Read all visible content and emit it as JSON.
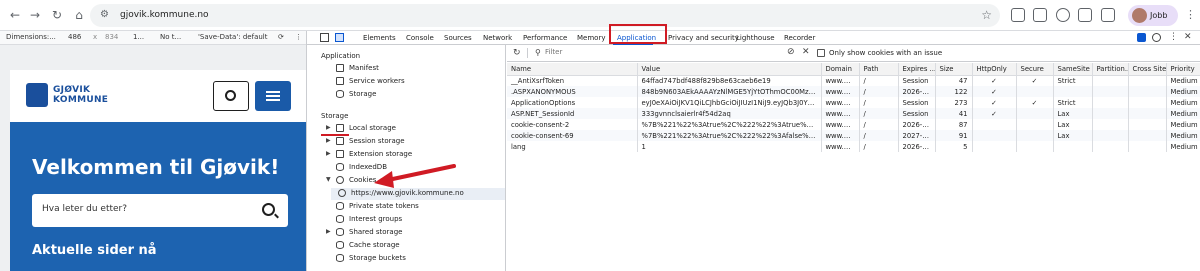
{
  "browser": {
    "url": "gjovik.kommune.no",
    "profile_name": "Jobb"
  },
  "device_toolbar": {
    "dimensions": "Dimensions:...",
    "width": "486",
    "times": "x",
    "height": "834",
    "zoom": "1...",
    "throttle": "No t...",
    "save_data": "'Save-Data': default"
  },
  "site": {
    "logo_line1": "GJØVIK",
    "logo_line2": "KOMMUNE",
    "hero_title": "Velkommen til Gjøvik!",
    "search_placeholder": "Hva leter du etter?",
    "section_heading": "Aktuelle sider nå"
  },
  "devtools": {
    "tabs": [
      "Elements",
      "Console",
      "Sources",
      "Network",
      "Performance",
      "Memory",
      "Application",
      "Privacy and security",
      "Lighthouse",
      "Recorder"
    ],
    "active_tab": "Application",
    "sidebar": {
      "application_heading": "Application",
      "application_items": [
        "Manifest",
        "Service workers",
        "Storage"
      ],
      "storage_heading": "Storage",
      "storage_items": [
        "Local storage",
        "Session storage",
        "Extension storage",
        "IndexedDB",
        "Cookies",
        "https://www.gjovik.kommune.no",
        "Private state tokens",
        "Interest groups",
        "Shared storage",
        "Cache storage",
        "Storage buckets"
      ]
    },
    "cookies": {
      "filter_placeholder": "Filter",
      "only_issue_label": "Only show cookies with an issue",
      "columns": [
        "Name",
        "Value",
        "Domain",
        "Path",
        "Expires ...",
        "Size",
        "HttpOnly",
        "Secure",
        "SameSite",
        "Partition...",
        "Cross Site",
        "Priority"
      ],
      "rows": [
        [
          "__AntiXsrfToken",
          "64ffad747bdf488f829b8e63caeb6e19",
          "www.gj...",
          "/",
          "Session",
          "47",
          "✓",
          "✓",
          "Strict",
          "",
          "",
          "Medium"
        ],
        [
          ".ASPXANONYMOUS",
          "848b9N603AEkAAAAYzNlMGE5YjYtOThmOC00MzVm...",
          "www.gj...",
          "/",
          "2026-03...",
          "122",
          "✓",
          "",
          "",
          "",
          "",
          "Medium"
        ],
        [
          "ApplicationOptions",
          "eyJ0eXAiOiJKV1QiLCJhbGciOiJIUzI1NiJ9.eyJQb3J0YWx...",
          "www.gj...",
          "/",
          "Session",
          "273",
          "✓",
          "✓",
          "Strict",
          "",
          "",
          "Medium"
        ],
        [
          "ASP.NET_SessionId",
          "333gvnnclsaierlr4f54d2aq",
          "www.gj...",
          "/",
          "Session",
          "41",
          "✓",
          "",
          "Lax",
          "",
          "",
          "Medium"
        ],
        [
          "cookie-consent-2",
          "%7B%221%22%3Atrue%2C%222%22%3Atrue%2C%22...",
          "www.gj...",
          "/",
          "2026-10...",
          "87",
          "",
          "",
          "Lax",
          "",
          "",
          "Medium"
        ],
        [
          "cookie-consent-69",
          "%7B%221%22%3Atrue%2C%222%22%3Afalse%2C%22...",
          "www.gj...",
          "/",
          "2027-01...",
          "91",
          "",
          "",
          "Lax",
          "",
          "",
          "Medium"
        ],
        [
          "lang",
          "1",
          "www.gj...",
          "/",
          "2026-01...",
          "5",
          "",
          "",
          "",
          "",
          "",
          "Medium"
        ]
      ]
    }
  },
  "colors": {
    "brand_blue": "#1d63b0",
    "highlight_red": "#d01b24",
    "devtools_accent": "#0b57d0"
  }
}
